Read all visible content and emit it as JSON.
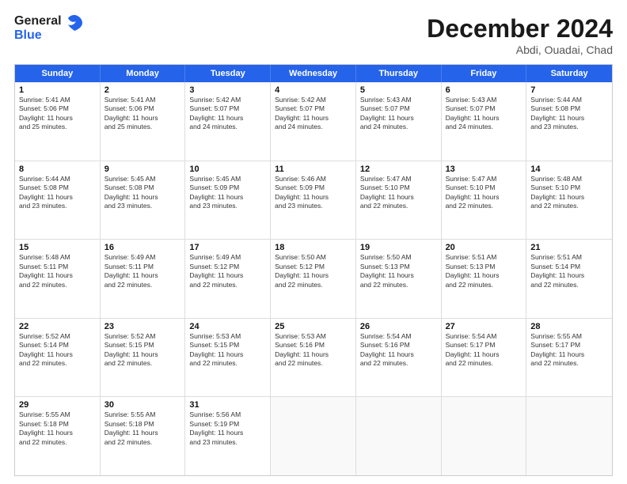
{
  "header": {
    "logo": {
      "line1": "General",
      "line2": "Blue"
    },
    "title": "December 2024",
    "location": "Abdi, Ouadai, Chad"
  },
  "calendar": {
    "weekdays": [
      "Sunday",
      "Monday",
      "Tuesday",
      "Wednesday",
      "Thursday",
      "Friday",
      "Saturday"
    ],
    "rows": [
      [
        {
          "day": "1",
          "info": "Sunrise: 5:41 AM\nSunset: 5:06 PM\nDaylight: 11 hours\nand 25 minutes."
        },
        {
          "day": "2",
          "info": "Sunrise: 5:41 AM\nSunset: 5:06 PM\nDaylight: 11 hours\nand 25 minutes."
        },
        {
          "day": "3",
          "info": "Sunrise: 5:42 AM\nSunset: 5:07 PM\nDaylight: 11 hours\nand 24 minutes."
        },
        {
          "day": "4",
          "info": "Sunrise: 5:42 AM\nSunset: 5:07 PM\nDaylight: 11 hours\nand 24 minutes."
        },
        {
          "day": "5",
          "info": "Sunrise: 5:43 AM\nSunset: 5:07 PM\nDaylight: 11 hours\nand 24 minutes."
        },
        {
          "day": "6",
          "info": "Sunrise: 5:43 AM\nSunset: 5:07 PM\nDaylight: 11 hours\nand 24 minutes."
        },
        {
          "day": "7",
          "info": "Sunrise: 5:44 AM\nSunset: 5:08 PM\nDaylight: 11 hours\nand 23 minutes."
        }
      ],
      [
        {
          "day": "8",
          "info": "Sunrise: 5:44 AM\nSunset: 5:08 PM\nDaylight: 11 hours\nand 23 minutes."
        },
        {
          "day": "9",
          "info": "Sunrise: 5:45 AM\nSunset: 5:08 PM\nDaylight: 11 hours\nand 23 minutes."
        },
        {
          "day": "10",
          "info": "Sunrise: 5:45 AM\nSunset: 5:09 PM\nDaylight: 11 hours\nand 23 minutes."
        },
        {
          "day": "11",
          "info": "Sunrise: 5:46 AM\nSunset: 5:09 PM\nDaylight: 11 hours\nand 23 minutes."
        },
        {
          "day": "12",
          "info": "Sunrise: 5:47 AM\nSunset: 5:10 PM\nDaylight: 11 hours\nand 22 minutes."
        },
        {
          "day": "13",
          "info": "Sunrise: 5:47 AM\nSunset: 5:10 PM\nDaylight: 11 hours\nand 22 minutes."
        },
        {
          "day": "14",
          "info": "Sunrise: 5:48 AM\nSunset: 5:10 PM\nDaylight: 11 hours\nand 22 minutes."
        }
      ],
      [
        {
          "day": "15",
          "info": "Sunrise: 5:48 AM\nSunset: 5:11 PM\nDaylight: 11 hours\nand 22 minutes."
        },
        {
          "day": "16",
          "info": "Sunrise: 5:49 AM\nSunset: 5:11 PM\nDaylight: 11 hours\nand 22 minutes."
        },
        {
          "day": "17",
          "info": "Sunrise: 5:49 AM\nSunset: 5:12 PM\nDaylight: 11 hours\nand 22 minutes."
        },
        {
          "day": "18",
          "info": "Sunrise: 5:50 AM\nSunset: 5:12 PM\nDaylight: 11 hours\nand 22 minutes."
        },
        {
          "day": "19",
          "info": "Sunrise: 5:50 AM\nSunset: 5:13 PM\nDaylight: 11 hours\nand 22 minutes."
        },
        {
          "day": "20",
          "info": "Sunrise: 5:51 AM\nSunset: 5:13 PM\nDaylight: 11 hours\nand 22 minutes."
        },
        {
          "day": "21",
          "info": "Sunrise: 5:51 AM\nSunset: 5:14 PM\nDaylight: 11 hours\nand 22 minutes."
        }
      ],
      [
        {
          "day": "22",
          "info": "Sunrise: 5:52 AM\nSunset: 5:14 PM\nDaylight: 11 hours\nand 22 minutes."
        },
        {
          "day": "23",
          "info": "Sunrise: 5:52 AM\nSunset: 5:15 PM\nDaylight: 11 hours\nand 22 minutes."
        },
        {
          "day": "24",
          "info": "Sunrise: 5:53 AM\nSunset: 5:15 PM\nDaylight: 11 hours\nand 22 minutes."
        },
        {
          "day": "25",
          "info": "Sunrise: 5:53 AM\nSunset: 5:16 PM\nDaylight: 11 hours\nand 22 minutes."
        },
        {
          "day": "26",
          "info": "Sunrise: 5:54 AM\nSunset: 5:16 PM\nDaylight: 11 hours\nand 22 minutes."
        },
        {
          "day": "27",
          "info": "Sunrise: 5:54 AM\nSunset: 5:17 PM\nDaylight: 11 hours\nand 22 minutes."
        },
        {
          "day": "28",
          "info": "Sunrise: 5:55 AM\nSunset: 5:17 PM\nDaylight: 11 hours\nand 22 minutes."
        }
      ],
      [
        {
          "day": "29",
          "info": "Sunrise: 5:55 AM\nSunset: 5:18 PM\nDaylight: 11 hours\nand 22 minutes."
        },
        {
          "day": "30",
          "info": "Sunrise: 5:55 AM\nSunset: 5:18 PM\nDaylight: 11 hours\nand 22 minutes."
        },
        {
          "day": "31",
          "info": "Sunrise: 5:56 AM\nSunset: 5:19 PM\nDaylight: 11 hours\nand 23 minutes."
        },
        {
          "day": "",
          "info": ""
        },
        {
          "day": "",
          "info": ""
        },
        {
          "day": "",
          "info": ""
        },
        {
          "day": "",
          "info": ""
        }
      ]
    ]
  }
}
